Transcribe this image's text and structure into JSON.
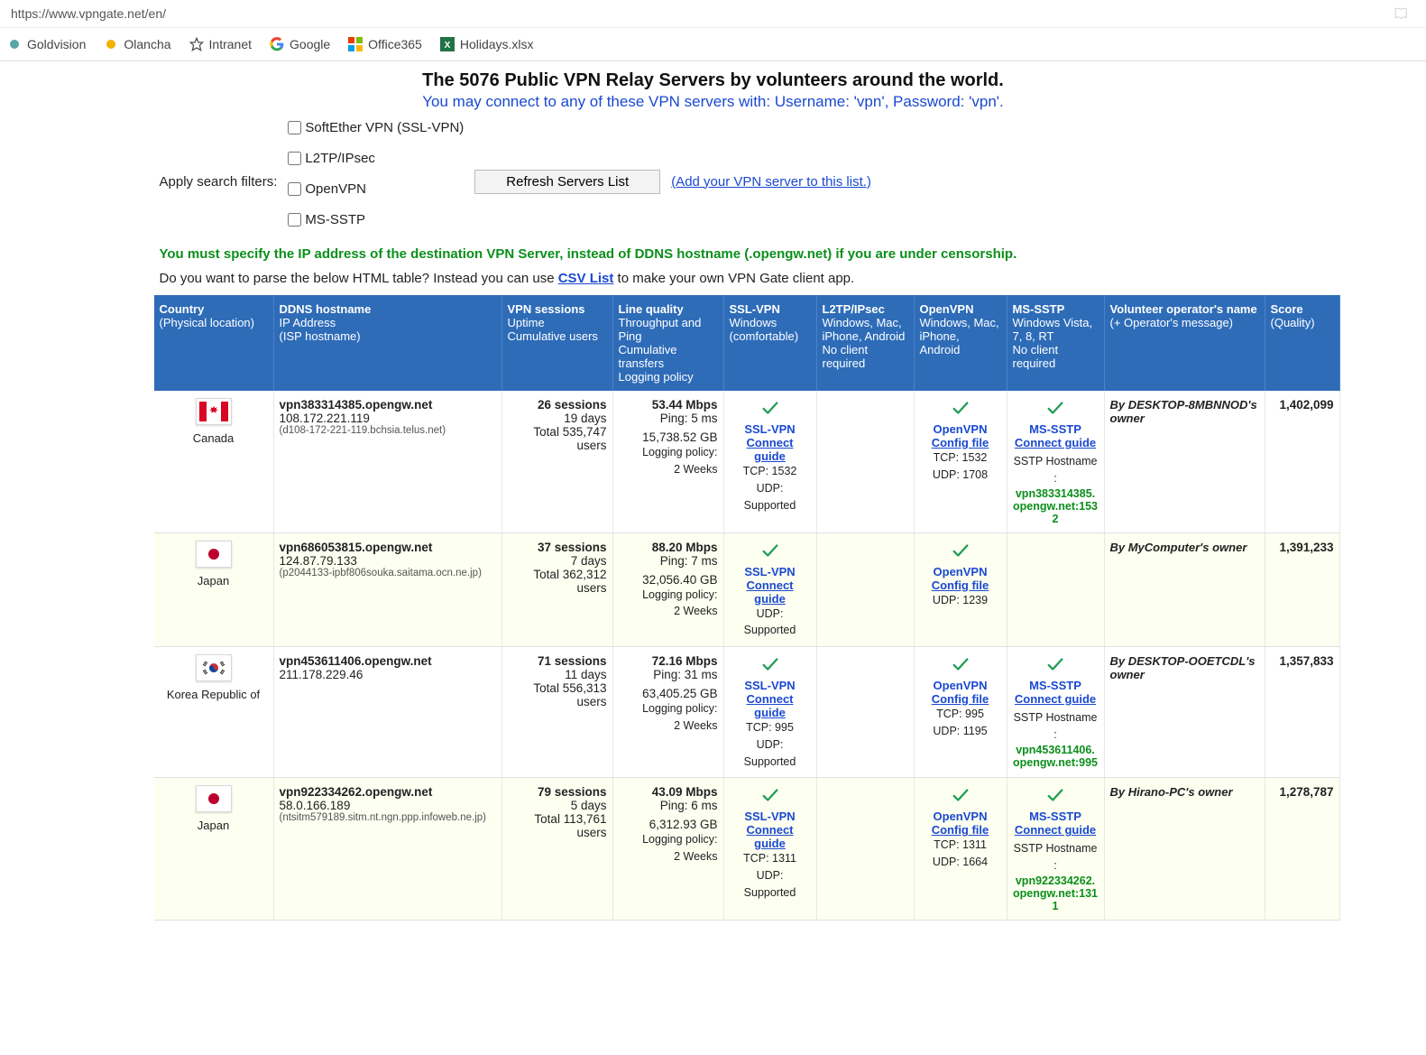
{
  "browser": {
    "url": "https://www.vpngate.net/en/",
    "bookmarks": [
      {
        "label": "Goldvision",
        "icon": "generic",
        "color": "#5aa6a6"
      },
      {
        "label": "Olancha",
        "icon": "dot",
        "color": "#f2b200"
      },
      {
        "label": "Intranet",
        "icon": "star",
        "color": "#555"
      },
      {
        "label": "Google",
        "icon": "google",
        "color": "#4285F4"
      },
      {
        "label": "Office365",
        "icon": "office",
        "color": "#eb3c00"
      },
      {
        "label": "Holidays.xlsx",
        "icon": "excel",
        "color": "#217346"
      }
    ]
  },
  "header": {
    "title": "The 5076 Public VPN Relay Servers by volunteers around the world.",
    "subtitle": "You may connect to any of these VPN servers with: Username: 'vpn', Password: 'vpn'."
  },
  "filters": {
    "label": "Apply search filters:",
    "options": [
      "SoftEther VPN (SSL-VPN)",
      "L2TP/IPsec",
      "OpenVPN",
      "MS-SSTP"
    ],
    "refresh_button": "Refresh Servers List",
    "add_link": "(Add your VPN server to this list.)"
  },
  "warning": "You must specify the IP address of the destination VPN Server, instead of DDNS hostname (.opengw.net) if you are under censorship.",
  "parse": {
    "before": "Do you want to parse the below HTML table? Instead you can use ",
    "link": "CSV List",
    "after": " to make your own VPN Gate client app."
  },
  "columns": {
    "country": {
      "h": "Country",
      "s": "(Physical location)"
    },
    "ddns": {
      "h": "DDNS hostname",
      "s1": "IP Address",
      "s2": "(ISP hostname)"
    },
    "sess": {
      "h": "VPN sessions",
      "s1": "Uptime",
      "s2": "Cumulative users"
    },
    "qual": {
      "h": "Line quality",
      "s1": "Throughput and Ping",
      "s2": "Cumulative transfers",
      "s3": "Logging policy"
    },
    "ssl": {
      "h": "SSL-VPN",
      "s1": "Windows",
      "s2": "(comfortable)"
    },
    "l2tp": {
      "h": "L2TP/IPsec",
      "s1": "Windows, Mac,",
      "s2": "iPhone, Android",
      "s3": "No client required"
    },
    "ovpn": {
      "h": "OpenVPN",
      "s1": "Windows, Mac,",
      "s2": "iPhone, Android"
    },
    "sstp": {
      "h": "MS-SSTP",
      "s1": "Windows Vista,",
      "s2": "7, 8, RT",
      "s3": "No client required"
    },
    "oper": {
      "h": "Volunteer operator's name",
      "s": "(+ Operator's message)"
    },
    "score": {
      "h": "Score",
      "s": "(Quality)"
    }
  },
  "proto_labels": {
    "ssl": "SSL-VPN",
    "ovpn": "OpenVPN",
    "sstp": "MS-SSTP",
    "connect": "Connect guide",
    "config": "Config file",
    "sstp_host_label": "SSTP Hostname :"
  },
  "rows": [
    {
      "country": "Canada",
      "flag": "ca",
      "ddns": "vpn383314385.opengw.net",
      "ip": "108.172.221.119",
      "isp": "(d108-172-221-119.bchsia.telus.net)",
      "sessions": "26 sessions",
      "uptime": "19 days",
      "users": "Total 535,747 users",
      "throughput": "53.44 Mbps",
      "ping": "Ping: 5 ms",
      "transfers": "15,738.52 GB",
      "logprefix": "Logging policy:",
      "log": "2 Weeks",
      "ssl": {
        "tcp": "TCP: 1532",
        "udp": "UDP: Supported"
      },
      "ovpn": {
        "tcp": "TCP: 1532",
        "udp": "UDP: 1708"
      },
      "sstp": {
        "host": "vpn383314385.opengw.net:1532"
      },
      "oper": "By DESKTOP-8MBNNOD's owner",
      "score": "1,402,099"
    },
    {
      "country": "Japan",
      "flag": "jp",
      "ddns": "vpn686053815.opengw.net",
      "ip": "124.87.79.133",
      "isp": "(p2044133-ipbf806souka.saitama.ocn.ne.jp)",
      "sessions": "37 sessions",
      "uptime": "7 days",
      "users": "Total 362,312 users",
      "throughput": "88.20 Mbps",
      "ping": "Ping: 7 ms",
      "transfers": "32,056.40 GB",
      "logprefix": "Logging policy:",
      "log": "2 Weeks",
      "ssl": {
        "udp": "UDP: Supported"
      },
      "ovpn": {
        "udp": "UDP: 1239"
      },
      "sstp": null,
      "oper": "By MyComputer's owner",
      "score": "1,391,233"
    },
    {
      "country": "Korea Republic of",
      "flag": "kr",
      "ddns": "vpn453611406.opengw.net",
      "ip": "211.178.229.46",
      "isp": "",
      "sessions": "71 sessions",
      "uptime": "11 days",
      "users": "Total 556,313 users",
      "throughput": "72.16 Mbps",
      "ping": "Ping: 31 ms",
      "transfers": "63,405.25 GB",
      "logprefix": "Logging policy:",
      "log": "2 Weeks",
      "ssl": {
        "tcp": "TCP: 995",
        "udp": "UDP: Supported"
      },
      "ovpn": {
        "tcp": "TCP: 995",
        "udp": "UDP: 1195"
      },
      "sstp": {
        "host": "vpn453611406.opengw.net:995"
      },
      "oper": "By DESKTOP-OOETCDL's owner",
      "score": "1,357,833"
    },
    {
      "country": "Japan",
      "flag": "jp",
      "ddns": "vpn922334262.opengw.net",
      "ip": "58.0.166.189",
      "isp": "(ntsitm579189.sitm.nt.ngn.ppp.infoweb.ne.jp)",
      "sessions": "79 sessions",
      "uptime": "5 days",
      "users": "Total 113,761 users",
      "throughput": "43.09 Mbps",
      "ping": "Ping: 6 ms",
      "transfers": "6,312.93 GB",
      "logprefix": "Logging policy:",
      "log": "2 Weeks",
      "ssl": {
        "tcp": "TCP: 1311",
        "udp": "UDP: Supported"
      },
      "ovpn": {
        "tcp": "TCP: 1311",
        "udp": "UDP: 1664"
      },
      "sstp": {
        "host": "vpn922334262.opengw.net:1311"
      },
      "oper": "By Hirano-PC's owner",
      "score": "1,278,787"
    }
  ]
}
